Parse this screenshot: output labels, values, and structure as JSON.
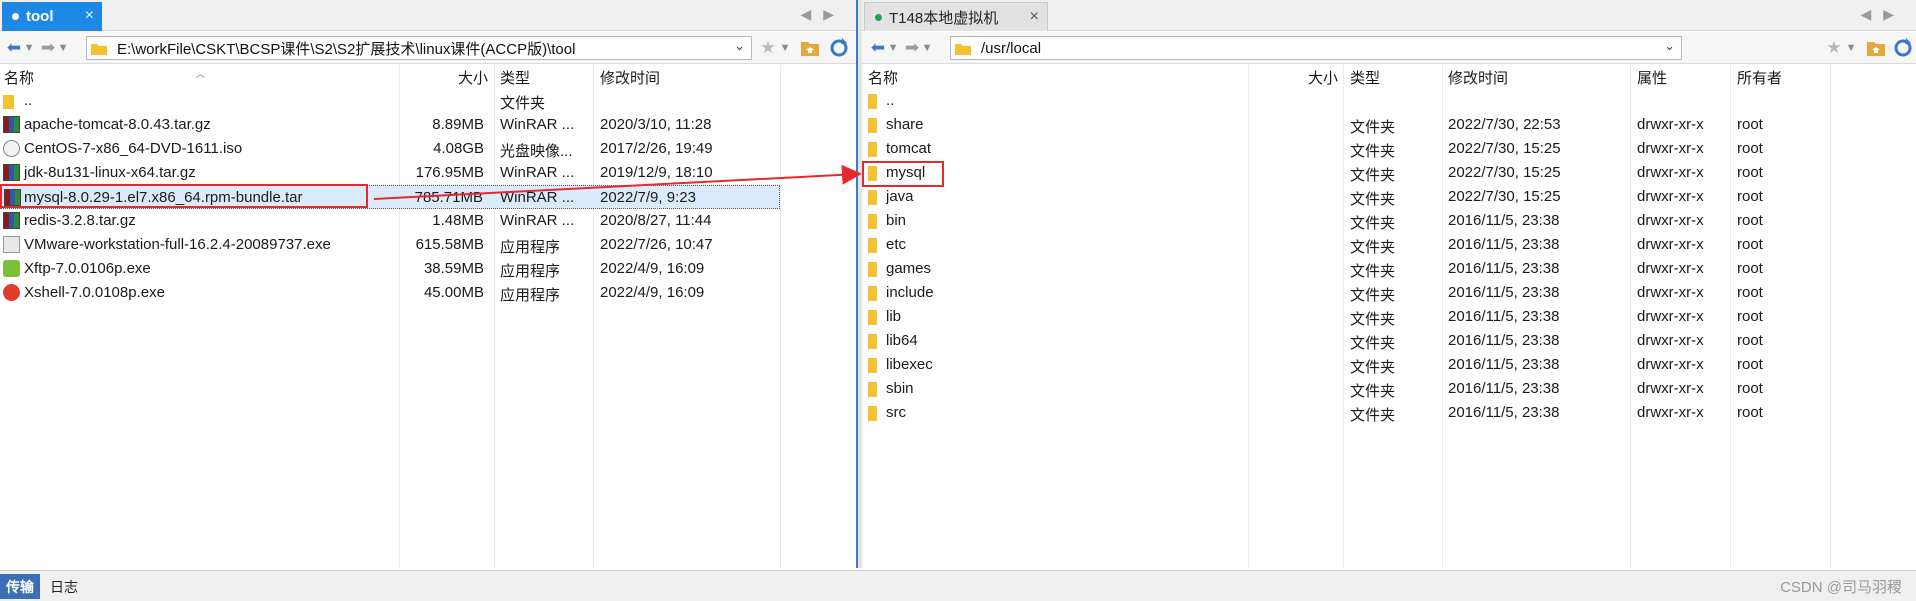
{
  "left": {
    "tab": {
      "label": "tool",
      "close": "×"
    },
    "tab_nav": "◀▶",
    "address": "E:\\workFile\\CSKT\\BCSP课件\\S2\\S2扩展技术\\linux课件(ACCP版)\\tool",
    "columns": {
      "name": "名称",
      "size": "大小",
      "type": "类型",
      "modified": "修改时间"
    },
    "rows": [
      {
        "name": "..",
        "size": "",
        "type": "文件夹",
        "modified": "",
        "icon": "up-folder-icon"
      },
      {
        "name": "apache-tomcat-8.0.43.tar.gz",
        "size": "8.89MB",
        "type": "WinRAR ...",
        "modified": "2020/3/10, 11:28",
        "icon": "winrar-icon"
      },
      {
        "name": "CentOS-7-x86_64-DVD-1611.iso",
        "size": "4.08GB",
        "type": "光盘映像...",
        "modified": "2017/2/26, 19:49",
        "icon": "disc-image-icon"
      },
      {
        "name": "jdk-8u131-linux-x64.tar.gz",
        "size": "176.95MB",
        "type": "WinRAR ...",
        "modified": "2019/12/9, 18:10",
        "icon": "winrar-icon"
      },
      {
        "name": "mysql-8.0.29-1.el7.x86_64.rpm-bundle.tar",
        "size": "785.71MB",
        "type": "WinRAR ...",
        "modified": "2022/7/9, 9:23",
        "icon": "winrar-icon"
      },
      {
        "name": "redis-3.2.8.tar.gz",
        "size": "1.48MB",
        "type": "WinRAR ...",
        "modified": "2020/8/27, 11:44",
        "icon": "winrar-icon"
      },
      {
        "name": "VMware-workstation-full-16.2.4-20089737.exe",
        "size": "615.58MB",
        "type": "应用程序",
        "modified": "2022/7/26, 10:47",
        "icon": "vmware-icon"
      },
      {
        "name": "Xftp-7.0.0106p.exe",
        "size": "38.59MB",
        "type": "应用程序",
        "modified": "2022/4/9, 16:09",
        "icon": "xftp-icon"
      },
      {
        "name": "Xshell-7.0.0108p.exe",
        "size": "45.00MB",
        "type": "应用程序",
        "modified": "2022/4/9, 16:09",
        "icon": "xshell-icon"
      }
    ]
  },
  "right": {
    "tab": {
      "label": "T148本地虚拟机",
      "close": "×"
    },
    "tab_nav": "◀▶",
    "address": "/usr/local",
    "columns": {
      "name": "名称",
      "size": "大小",
      "type": "类型",
      "modified": "修改时间",
      "attrs": "属性",
      "owner": "所有者"
    },
    "rows": [
      {
        "name": "..",
        "type": "",
        "modified": "",
        "attrs": "",
        "owner": ""
      },
      {
        "name": "share",
        "type": "文件夹",
        "modified": "2022/7/30, 22:53",
        "attrs": "drwxr-xr-x",
        "owner": "root"
      },
      {
        "name": "tomcat",
        "type": "文件夹",
        "modified": "2022/7/30, 15:25",
        "attrs": "drwxr-xr-x",
        "owner": "root"
      },
      {
        "name": "mysql",
        "type": "文件夹",
        "modified": "2022/7/30, 15:25",
        "attrs": "drwxr-xr-x",
        "owner": "root"
      },
      {
        "name": "java",
        "type": "文件夹",
        "modified": "2022/7/30, 15:25",
        "attrs": "drwxr-xr-x",
        "owner": "root"
      },
      {
        "name": "bin",
        "type": "文件夹",
        "modified": "2016/11/5, 23:38",
        "attrs": "drwxr-xr-x",
        "owner": "root"
      },
      {
        "name": "etc",
        "type": "文件夹",
        "modified": "2016/11/5, 23:38",
        "attrs": "drwxr-xr-x",
        "owner": "root"
      },
      {
        "name": "games",
        "type": "文件夹",
        "modified": "2016/11/5, 23:38",
        "attrs": "drwxr-xr-x",
        "owner": "root"
      },
      {
        "name": "include",
        "type": "文件夹",
        "modified": "2016/11/5, 23:38",
        "attrs": "drwxr-xr-x",
        "owner": "root"
      },
      {
        "name": "lib",
        "type": "文件夹",
        "modified": "2016/11/5, 23:38",
        "attrs": "drwxr-xr-x",
        "owner": "root"
      },
      {
        "name": "lib64",
        "type": "文件夹",
        "modified": "2016/11/5, 23:38",
        "attrs": "drwxr-xr-x",
        "owner": "root"
      },
      {
        "name": "libexec",
        "type": "文件夹",
        "modified": "2016/11/5, 23:38",
        "attrs": "drwxr-xr-x",
        "owner": "root"
      },
      {
        "name": "sbin",
        "type": "文件夹",
        "modified": "2016/11/5, 23:38",
        "attrs": "drwxr-xr-x",
        "owner": "root"
      },
      {
        "name": "src",
        "type": "文件夹",
        "modified": "2016/11/5, 23:38",
        "attrs": "drwxr-xr-x",
        "owner": "root"
      }
    ]
  },
  "bottom": {
    "tab_transfer": "传输",
    "tab_log": "日志",
    "watermark": "CSDN @司马羽稷"
  },
  "colors": {
    "accent": "#1e88e5",
    "highlight_box": "#e8282d",
    "selection": "#dcebfb",
    "folder": "#f2c230"
  }
}
